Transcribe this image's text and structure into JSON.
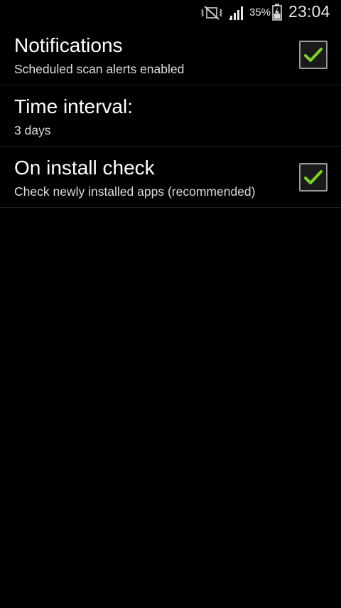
{
  "status_bar": {
    "icons": [
      "vibrate-mute-icon",
      "signal-strength-icon",
      "battery-charging-icon"
    ],
    "battery_percent": "35%",
    "time": "23:04"
  },
  "settings": [
    {
      "title": "Notifications",
      "summary": "Scheduled scan alerts enabled",
      "checked": true
    },
    {
      "title": "Time interval:",
      "summary": "3 days"
    },
    {
      "title": "On install check",
      "summary": "Check newly installed apps (recommended)",
      "checked": true
    }
  ],
  "colors": {
    "background": "#000000",
    "checkmark": "#7ed321",
    "divider": "#1d1d1d"
  }
}
